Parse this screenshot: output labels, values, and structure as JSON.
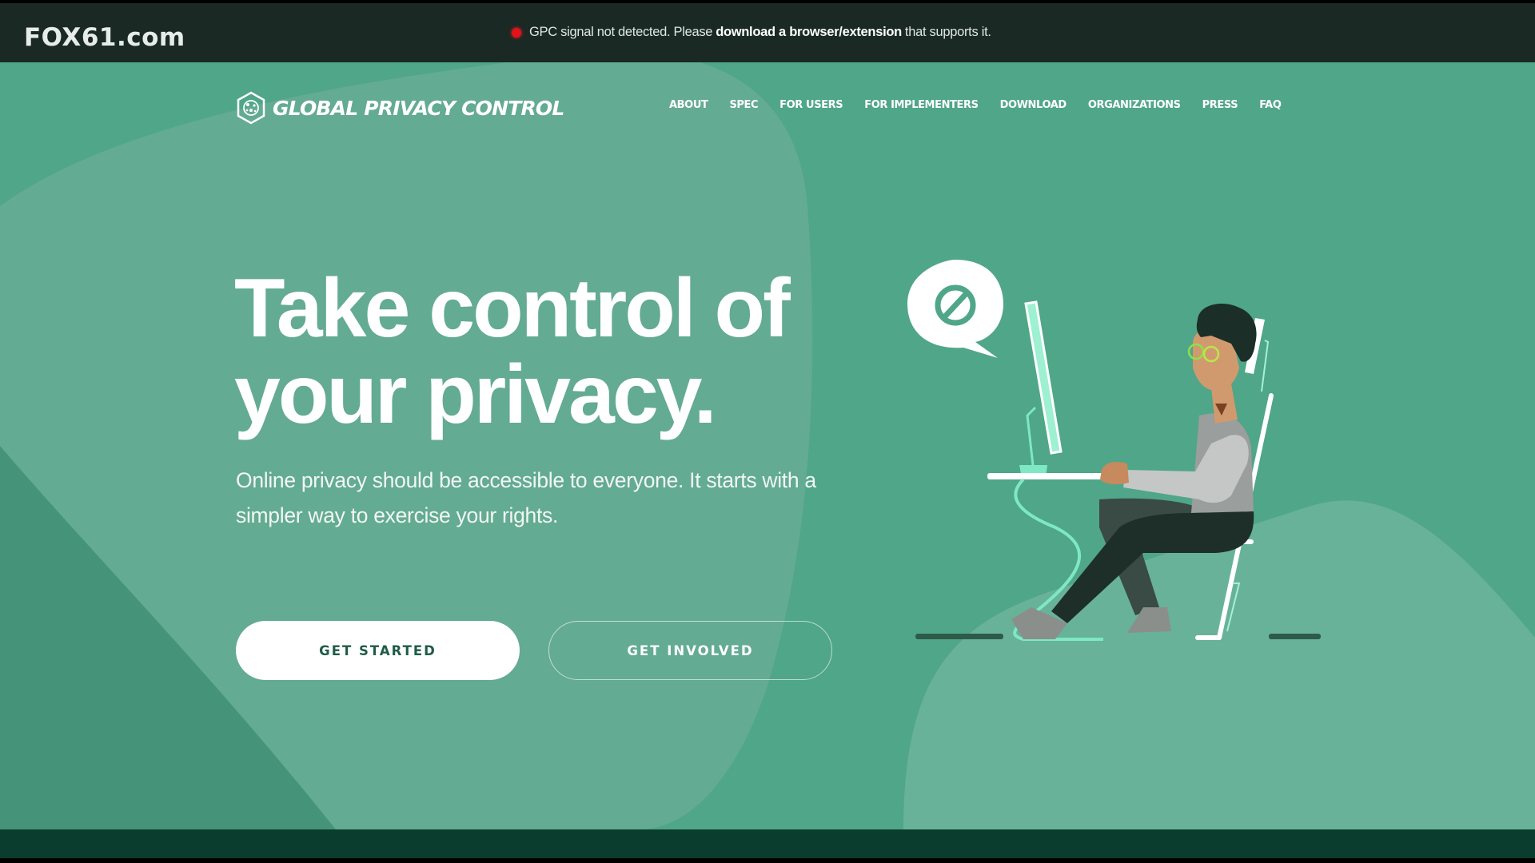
{
  "broadcast": {
    "station_logo": "FOX61.com"
  },
  "gpc_banner": {
    "status_color": "#e3121b",
    "text_before": "GPC signal not detected. Please",
    "link_text": "download a browser/extension",
    "text_after": "that supports it."
  },
  "site": {
    "brand_name": "GLOBAL PRIVACY CONTROL",
    "brand_icon": "hexagon-logo-icon",
    "nav": [
      {
        "label": "ABOUT"
      },
      {
        "label": "SPEC"
      },
      {
        "label": "FOR USERS"
      },
      {
        "label": "FOR IMPLEMENTERS"
      },
      {
        "label": "DOWNLOAD"
      },
      {
        "label": "ORGANIZATIONS"
      },
      {
        "label": "PRESS"
      },
      {
        "label": "FAQ"
      }
    ]
  },
  "hero": {
    "headline_line1": "Take control of",
    "headline_line2": "your privacy.",
    "subtext": "Online privacy should be accessible to everyone. It starts with a simpler way to exercise your rights.",
    "primary_button": "GET STARTED",
    "secondary_button": "GET INVOLVED",
    "illustration": "person-at-computer-illustration",
    "speech_icon": "no-entry-icon"
  },
  "colors": {
    "background": "#50a688",
    "blob_light": "#65ad94",
    "blob_dark": "#45947a",
    "top_bar": "#1a2924",
    "bottom_band": "#0b3d2f",
    "accent_mint": "#7ee8c4",
    "button_text": "#1f5b48"
  }
}
